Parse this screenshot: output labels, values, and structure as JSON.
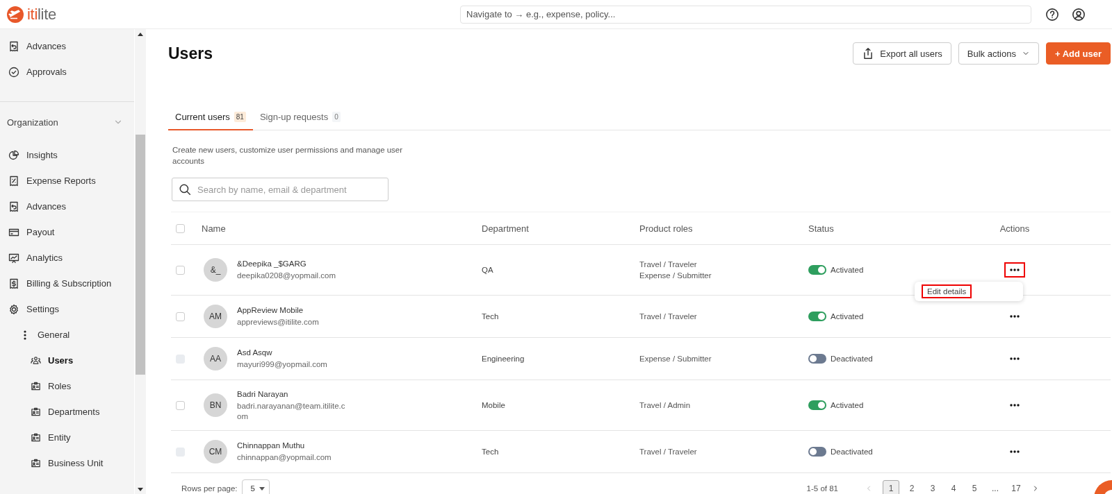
{
  "header": {
    "logo": {
      "accent": "iti",
      "rest": "lite"
    },
    "nav_placeholder": "Navigate to → e.g., expense, policy..."
  },
  "sidebar": {
    "top_items": [
      {
        "label": "Advances",
        "selected": false
      },
      {
        "label": "Approvals",
        "selected": false
      }
    ],
    "section": {
      "label": "Organization",
      "expanded": true
    },
    "items": [
      {
        "label": "Insights",
        "selected": false
      },
      {
        "label": "Expense Reports",
        "selected": false
      },
      {
        "label": "Advances",
        "selected": false
      },
      {
        "label": "Payout",
        "selected": false
      },
      {
        "label": "Analytics",
        "selected": false
      },
      {
        "label": "Billing & Subscription",
        "selected": false
      },
      {
        "label": "Settings",
        "selected": false,
        "children": [
          {
            "label": "General",
            "selected": false,
            "children": [
              {
                "label": "Users",
                "selected": true
              },
              {
                "label": "Roles",
                "selected": false
              },
              {
                "label": "Departments",
                "selected": false
              },
              {
                "label": "Entity",
                "selected": false
              },
              {
                "label": "Business Unit",
                "selected": false
              }
            ]
          }
        ]
      }
    ]
  },
  "page": {
    "title": "Users",
    "buttons": [
      {
        "label": "Export all users",
        "kind": "export"
      },
      {
        "label": "Bulk actions",
        "kind": "dropdown"
      },
      {
        "label": "+ Add user",
        "kind": "primary"
      }
    ],
    "tabs": [
      {
        "label": "Current users",
        "count": "81",
        "selected": true
      },
      {
        "label": "Sign-up requests",
        "count": "0",
        "selected": false
      }
    ],
    "description": "Create new users, customize user permissions and manage user accounts",
    "search": {
      "placeholder": "Search by name, email & department"
    }
  },
  "table": {
    "columns": [
      "Name",
      "Department",
      "Product roles",
      "Status",
      "Actions"
    ],
    "all_checked": false,
    "rows": [
      {
        "initials": "&_",
        "name": "&Deepika _$GARG",
        "email": "deepika0208@yopmail.com",
        "department": "QA",
        "roles": [
          "Travel / Traveler",
          "Expense / Submitter"
        ],
        "status": "Activated",
        "on": true,
        "checked": false,
        "disabled": false,
        "highlighted": true,
        "menu": [
          {
            "label": "Edit details",
            "highlighted": true
          }
        ]
      },
      {
        "initials": "AM",
        "name": "AppReview Mobile",
        "email": "appreviews@itilite.com",
        "department": "Tech",
        "roles": [
          "Travel / Traveler"
        ],
        "status": "Activated",
        "on": true,
        "checked": false,
        "disabled": false,
        "highlighted": false
      },
      {
        "initials": "AA",
        "name": "Asd Asqw",
        "email": "mayuri999@yopmail.com",
        "department": "Engineering",
        "roles": [
          "Expense / Submitter"
        ],
        "status": "Deactivated",
        "on": false,
        "checked": false,
        "disabled": true,
        "highlighted": false
      },
      {
        "initials": "BN",
        "name": "Badri Narayan",
        "email": "badri.narayanan@team.itilite.com",
        "department": "Mobile",
        "roles": [
          "Travel / Admin"
        ],
        "status": "Activated",
        "on": true,
        "checked": false,
        "disabled": false,
        "highlighted": false
      },
      {
        "initials": "CM",
        "name": "Chinnappan Muthu",
        "email": "chinnappan@yopmail.com",
        "department": "Tech",
        "roles": [
          "Travel / Traveler"
        ],
        "status": "Deactivated",
        "on": false,
        "checked": false,
        "disabled": true,
        "highlighted": false
      }
    ]
  },
  "pagination": {
    "rows_label": "Rows per page:",
    "rows_value": "5",
    "range": "1-5 of 81",
    "prev_disabled": true,
    "next_disabled": false,
    "pages": [
      {
        "label": "1",
        "selected": true
      },
      {
        "label": "2",
        "selected": false
      },
      {
        "label": "3",
        "selected": false
      },
      {
        "label": "4",
        "selected": false
      },
      {
        "label": "5",
        "selected": false
      },
      {
        "label": "...",
        "selected": false
      },
      {
        "label": "17",
        "selected": false
      }
    ]
  }
}
